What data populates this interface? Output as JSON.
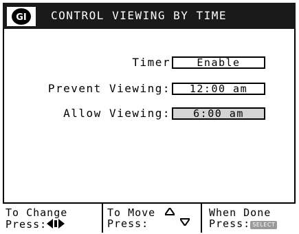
{
  "header": {
    "logo_text": "GI",
    "title": "CONTROL VIEWING BY TIME"
  },
  "settings": [
    {
      "label": "Timer",
      "value": "Enable",
      "selected": false
    },
    {
      "label": "Prevent Viewing:",
      "value": "12:00 am",
      "selected": false
    },
    {
      "label": "Allow Viewing:",
      "value": "6:00 am",
      "selected": true
    }
  ],
  "footer": {
    "change": {
      "line1": "To Change",
      "line2": "Press:",
      "icon": "left-right-arrows-icon"
    },
    "move": {
      "line1": "To Move",
      "line2": "Press:",
      "icon": "up-down-arrows-icon"
    },
    "done": {
      "line1": "When Done",
      "line2": "Press:",
      "key_label": "SELECT"
    }
  },
  "colors": {
    "header_bg": "#1a1a1a",
    "header_text": "#ffffff",
    "selected_field_bg": "#d4d4d4",
    "select_key_bg": "#9a9a9a"
  }
}
